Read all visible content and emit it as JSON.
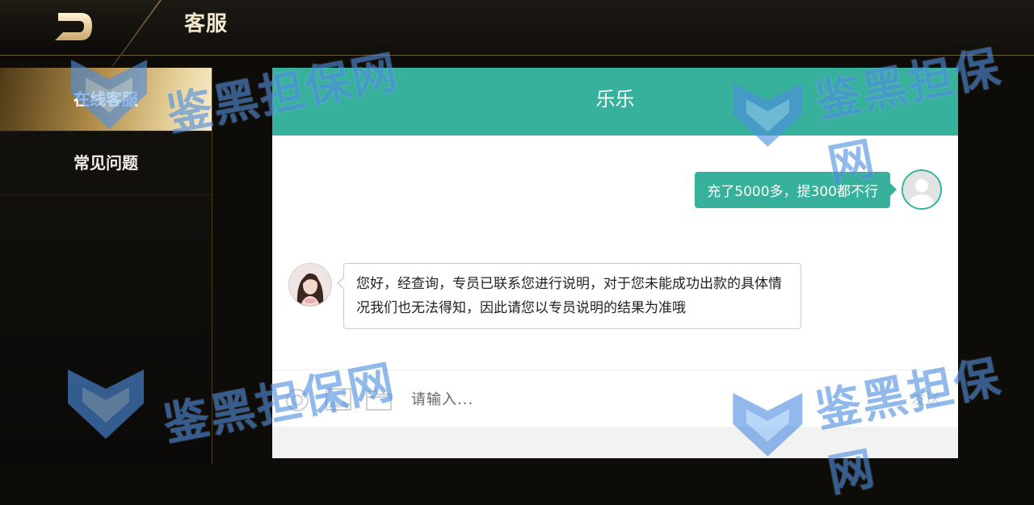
{
  "header": {
    "back_icon": "back-arrow-icon",
    "title": "客服"
  },
  "sidebar": {
    "items": [
      {
        "label": "在线客服",
        "active": true
      },
      {
        "label": "常见问题",
        "active": false
      }
    ]
  },
  "chat": {
    "agent_name": "乐乐",
    "messages": [
      {
        "from": "user",
        "text": "充了5000多，提300都不行"
      },
      {
        "from": "agent",
        "text": "您好，经查询，专员已联系您进行说明，对于您未能成功出款的具体情况我们也无法得知，因此请您以专员说明的结果为准哦"
      }
    ],
    "input": {
      "placeholder": "请输入...",
      "value": ""
    },
    "send_label": "发送",
    "tools": [
      "emoji-icon",
      "image-icon",
      "folder-icon"
    ]
  },
  "watermark": {
    "text": "鉴黑担保网"
  },
  "colors": {
    "accent": "#37b09c",
    "gold": "#c9a86a",
    "watermark": "#4f8fe0"
  }
}
